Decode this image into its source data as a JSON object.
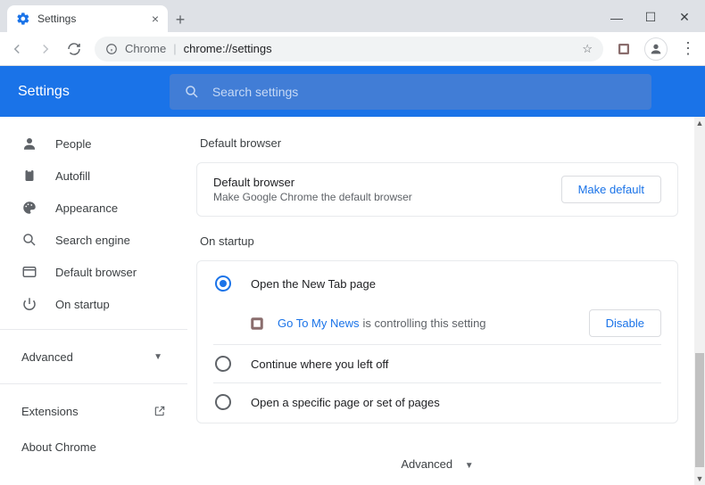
{
  "window": {
    "tab_title": "Settings",
    "new_tab_tooltip": "+",
    "win_min": "—",
    "win_max": "☐",
    "win_close": "✕"
  },
  "addressbar": {
    "scheme_label": "Chrome",
    "url_path": "chrome://settings"
  },
  "header": {
    "title": "Settings",
    "search_placeholder": "Search settings"
  },
  "sidebar": {
    "items": [
      {
        "label": "People"
      },
      {
        "label": "Autofill"
      },
      {
        "label": "Appearance"
      },
      {
        "label": "Search engine"
      },
      {
        "label": "Default browser"
      },
      {
        "label": "On startup"
      }
    ],
    "advanced": "Advanced",
    "extensions": "Extensions",
    "about": "About Chrome"
  },
  "content": {
    "default_browser": {
      "section": "Default browser",
      "title": "Default browser",
      "subtitle": "Make Google Chrome the default browser",
      "button": "Make default"
    },
    "on_startup": {
      "section": "On startup",
      "opt_newtab": "Open the New Tab page",
      "ext_name": "Go To My News",
      "ext_desc": "is controlling this setting",
      "disable": "Disable",
      "opt_continue": "Continue where you left off",
      "opt_specific": "Open a specific page or set of pages"
    },
    "advanced_footer": "Advanced"
  }
}
